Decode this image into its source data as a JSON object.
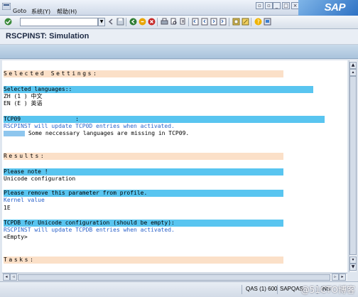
{
  "menu": {
    "items": [
      "Goto",
      "系统(Y)",
      "帮助(H)"
    ]
  },
  "toolbar": {
    "command_value": ""
  },
  "title": "RSCPINST: Simulation",
  "content": {
    "selected_settings_header": "Selected Settings:",
    "selected_languages_label": "Selected languages::",
    "languages": [
      "ZH (1 ) 中文",
      "EN (E ) 英语"
    ],
    "tcp09_label": "TCP09                :",
    "tcp0d_note": "RSCPINST will update TCP0D entries when activated.",
    "missing_note": "Some neccessary languages are missing in TCP09.",
    "results_header": "Results:",
    "please_note_label": "Please note !",
    "unicode_config": "Unicode configuration",
    "remove_param_label": "Please remove this parameter from profile.",
    "kernel_value_label": "Kernel value",
    "kernel_value": "1E",
    "tcpdb_label": "TCPDB for Unicode configuration (should be empty):",
    "tcpdb_note": "RSCPINST will update TCPDB entries when activated.",
    "tcpdb_value": "<Empty>",
    "tasks_header": "Tasks:"
  },
  "status": {
    "system": "QAS (1) 600",
    "host": "SAPQAS",
    "mode": "INS"
  },
  "watermark": "@51CTO博客",
  "logo": "SAP",
  "colors": {
    "section_header": "#fbe0c8",
    "highlight": "#59c5f0",
    "blue_text": "#2b62c9"
  }
}
